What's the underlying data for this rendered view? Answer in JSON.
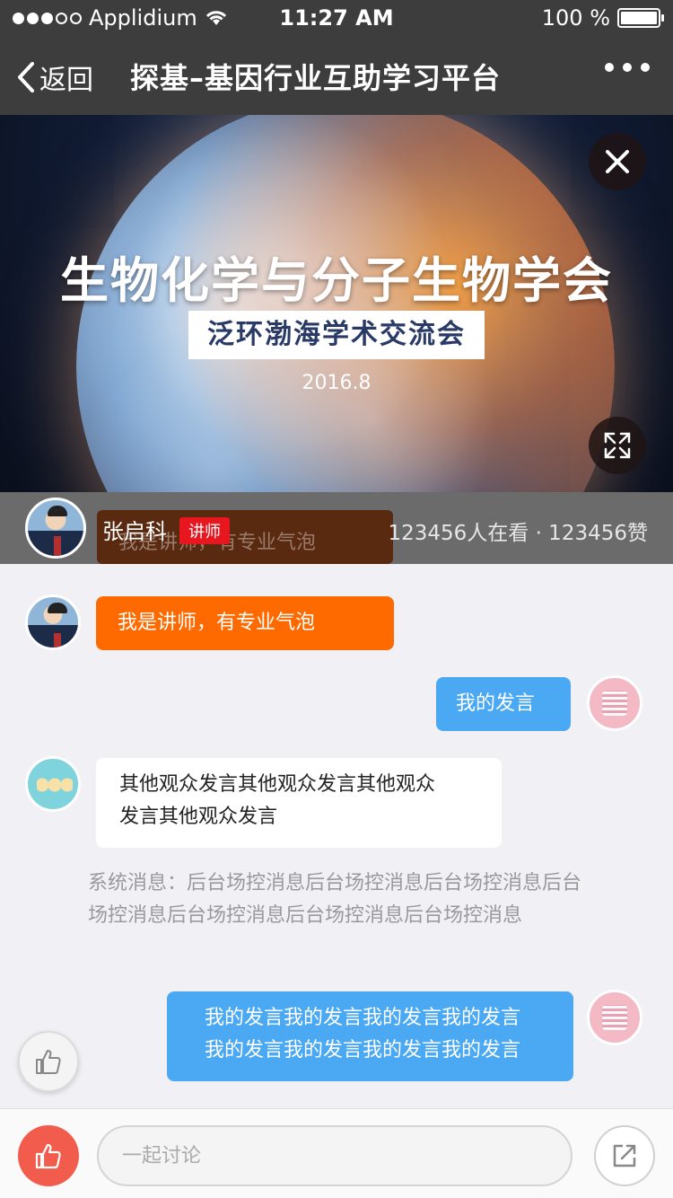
{
  "status_bar": {
    "carrier": "Applidium",
    "time": "11:27 AM",
    "battery": "100 %",
    "battery_level": 1.0,
    "signal_bars_filled": 3,
    "signal_bars_total": 5
  },
  "nav": {
    "back_label": "返回",
    "title": "探基–基因行业互助学习平台",
    "more_icon": "more-dots-icon"
  },
  "banner": {
    "title": "生物化学与分子生物学会",
    "subtitle": "泛环渤海学术交流会",
    "date": "2016.8",
    "close_icon": "close-icon",
    "fullscreen_icon": "fullscreen-icon"
  },
  "presenter": {
    "name": "张启科",
    "tag": "讲师",
    "stats": "123456人在看 · 123456赞",
    "ghost_bubble_text": "我是讲师，有专业气泡"
  },
  "chat": {
    "messages": [
      {
        "type": "lecturer",
        "text": "我是讲师，有专业气泡"
      },
      {
        "type": "self",
        "text": "我的发言"
      },
      {
        "type": "other",
        "text_line1": "其他观众发言其他观众发言其他观众",
        "text_line2": "发言其他观众发言"
      },
      {
        "type": "self",
        "text_line1": "我的发言我的发言我的发言我的发言",
        "text_line2": "我的发言我的发言我的发言我的发言"
      }
    ],
    "system_message": "系统消息：后台场控消息后台场控消息后台场控消息后台场控消息后台场控消息后台场控消息后台场控消息"
  },
  "bottom_bar": {
    "input_placeholder": "一起讨论",
    "like_icon": "thumbs-up-icon",
    "share_icon": "share-icon"
  },
  "colors": {
    "lecturer_bubble": "#ff6a00",
    "self_bubble": "#4aa9f2",
    "like_button": "#f25c4d",
    "tag": "#e8161e",
    "navbar": "#3d3d3d"
  }
}
